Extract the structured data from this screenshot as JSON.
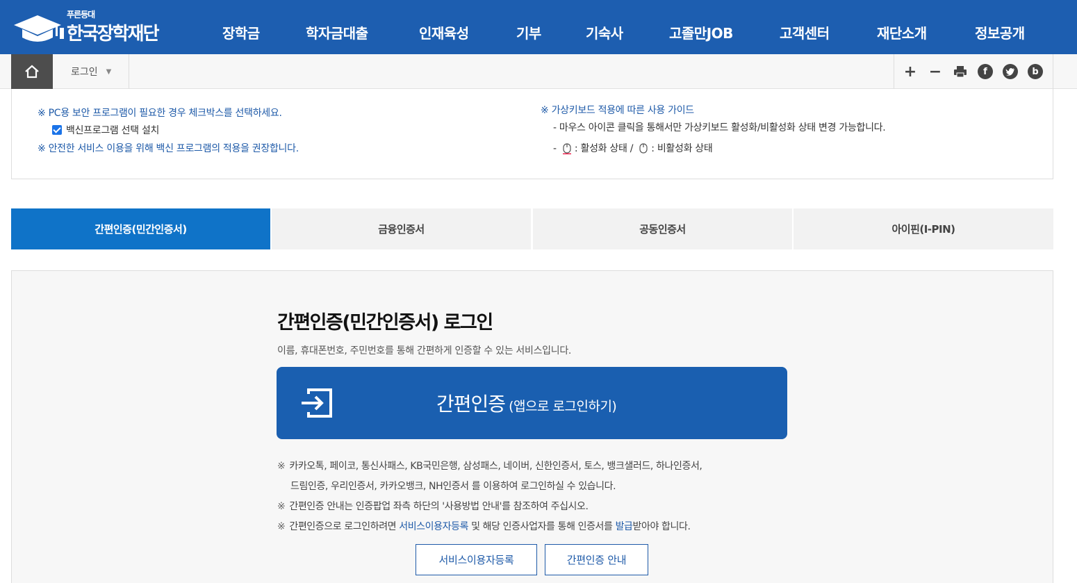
{
  "header": {
    "logo_small": "푸른등대",
    "logo_main": "한국장학재단",
    "nav": [
      "장학금",
      "학자금대출",
      "인재육성",
      "기부",
      "기숙사",
      "고졸만JOB",
      "고객센터",
      "재단소개",
      "정보공개"
    ]
  },
  "locbar": {
    "current": "로그인",
    "tools": [
      "zoom-in",
      "zoom-out",
      "print",
      "facebook",
      "twitter",
      "blog"
    ],
    "fb_glyph": "f",
    "blog_glyph": "b"
  },
  "notice": {
    "left_1": "※ PC용 보안 프로그램이 필요한 경우 체크박스를 선택하세요.",
    "checkbox_label": "백신프로그램 선택 설치",
    "checkbox_checked": true,
    "left_2": "※ 안전한 서비스 이용을 위해 백신 프로그램의 적용을 권장합니다.",
    "right_title": "※ 가상키보드 적용에 따른 사용 가이드",
    "right_1": "- 마우스 아이콘 클릭을 통해서만 가상키보드 활성화/비활성화 상태 변경 가능합니다.",
    "right_2_prefix": "-",
    "right_2_active": ": 활성화 상태 /",
    "right_2_inactive": ": 비활성화 상태"
  },
  "tabs": [
    "간편인증(민간인증서)",
    "금융인증서",
    "공동인증서",
    "아이핀(I-PIN)"
  ],
  "panel": {
    "title": "간편인증(민간인증서) 로그인",
    "desc": "이름, 휴대폰번호, 주민번호를 통해 간편하게 인증할 수 있는 서비스입니다.",
    "button_main": "간편인증",
    "button_sub": "(앱으로 로그인하기)",
    "note_mark": "※",
    "note_1": "카카오톡, 페이코, 통신사패스, KB국민은행, 삼성패스, 네이버, 신한인증서, 토스, 뱅크샐러드, 하나인증서,",
    "note_1b": "드림인증, 우리인증서, 카카오뱅크, NH인증서 를 이용하여 로그인하실 수 있습니다.",
    "note_2": "간편인증 안내는 인증팝업 좌측 하단의 '사용방법 안내'를 참조하여 주십시오.",
    "note_3_a": "간편인증으로 로그인하려면 ",
    "note_3_link1": "서비스이용자등록",
    "note_3_b": " 및 해당 인증사업자를 통해 인증서를 ",
    "note_3_link2": "발급",
    "note_3_c": "받아야 합니다.",
    "btn_register": "서비스이용자등록",
    "btn_guide": "간편인증 안내"
  },
  "colors": {
    "header_bg": "#1d5eb0",
    "tab_active": "#0f73c8",
    "primary_button": "#1a5fb0",
    "link_blue": "#1e5aa8"
  }
}
